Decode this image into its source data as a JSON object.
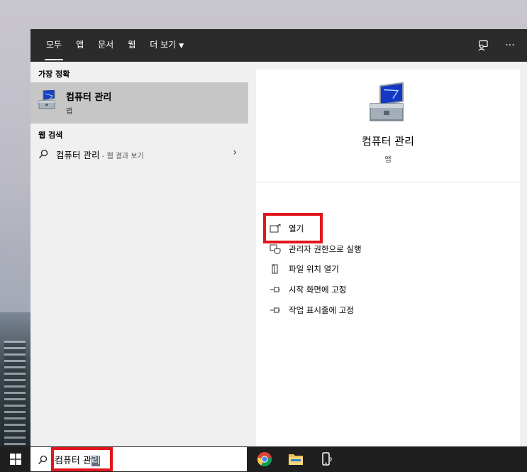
{
  "tabs": [
    {
      "label": "모두"
    },
    {
      "label": "앱"
    },
    {
      "label": "문서"
    },
    {
      "label": "웹"
    },
    {
      "label": "더 보기"
    }
  ],
  "top_icons": [
    "feedback-icon",
    "more-icon"
  ],
  "more_label": "···",
  "left": {
    "best_match_heading": "가장 정확",
    "best_match_title": "컴퓨터 관리",
    "best_match_subtitle": "앱",
    "web_heading": "웹 검색",
    "web_query": "컴퓨터 관리",
    "web_suffix": " - 웹 결과 보기",
    "web_chevron": "›"
  },
  "right": {
    "title": "컴퓨터 관리",
    "subtitle": "앱",
    "actions": [
      {
        "label": "열기",
        "icon": "open-icon"
      },
      {
        "label": "관리자 권한으로 실행",
        "icon": "shield-icon"
      },
      {
        "label": "파일 위치 열기",
        "icon": "file-location-icon"
      },
      {
        "label": "시작 화면에 고정",
        "icon": "pin-icon"
      },
      {
        "label": "작업 표시줄에 고정",
        "icon": "pin-taskbar-icon"
      }
    ]
  },
  "taskbar": {
    "search_text_plain": "컴퓨터 관",
    "search_text_selected": "리",
    "apps": [
      "chrome-icon",
      "file-explorer-icon",
      "phone-icon"
    ]
  },
  "colors": {
    "highlight": "#e3151c",
    "top_bar": "#2b2b2b",
    "best_match_bg": "#c6c6c6",
    "taskbar": "#1f1f1f"
  }
}
